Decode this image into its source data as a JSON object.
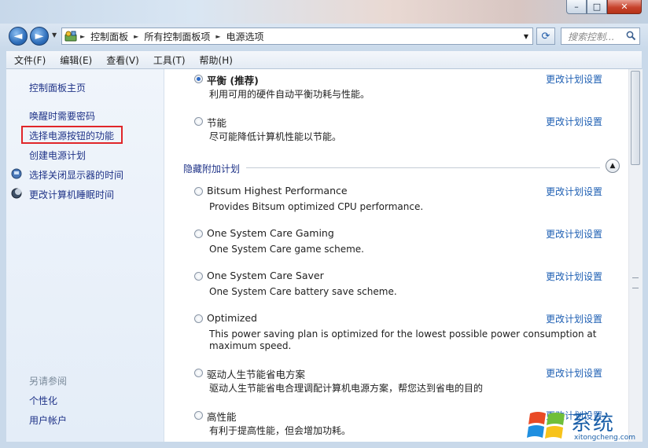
{
  "titlebar": {
    "minimize_label": "–",
    "maximize_label": "□",
    "close_label": "✕"
  },
  "navigation": {
    "back_label": "◄",
    "forward_label": "►",
    "breadcrumbs": [
      "控制面板",
      "所有控制面板项",
      "电源选项"
    ],
    "search_placeholder": "搜索控制..."
  },
  "menu": [
    "文件(F)",
    "编辑(E)",
    "查看(V)",
    "工具(T)",
    "帮助(H)"
  ],
  "sidebar": {
    "home": "控制面板主页",
    "links": [
      {
        "label": "唤醒时需要密码",
        "icon": ""
      },
      {
        "label": "选择电源按钮的功能",
        "icon": "",
        "highlighted": true
      },
      {
        "label": "创建电源计划",
        "icon": ""
      },
      {
        "label": "选择关闭显示器的时间",
        "icon": "monitor-icon"
      },
      {
        "label": "更改计算机睡眠时间",
        "icon": "moon-icon"
      }
    ],
    "see_also_header": "另请参阅",
    "see_also": [
      "个性化",
      "用户帐户"
    ]
  },
  "main": {
    "change_link_label": "更改计划设置",
    "top_plans": [
      {
        "name": "平衡 (推荐)",
        "desc": "利用可用的硬件自动平衡功耗与性能。",
        "selected": true
      },
      {
        "name": "节能",
        "desc": "尽可能降低计算机性能以节能。",
        "selected": false
      }
    ],
    "hidden_header": "隐藏附加计划",
    "hidden_plans": [
      {
        "name": "Bitsum Highest Performance",
        "desc": "Provides Bitsum optimized CPU performance."
      },
      {
        "name": "One System Care Gaming",
        "desc": "One System Care game scheme."
      },
      {
        "name": "One System Care Saver",
        "desc": "One System Care battery save scheme."
      },
      {
        "name": "Optimized",
        "desc": "This power saving plan is optimized for the lowest possible power consumption at maximum speed."
      },
      {
        "name": "驱动人生节能省电方案",
        "desc": "驱动人生节能省电合理调配计算机电源方案，帮您达到省电的目的"
      },
      {
        "name": "高性能",
        "desc": "有利于提高性能，但会增加功耗。"
      }
    ]
  },
  "watermark": {
    "text": "系统",
    "url": "xitongcheng.com"
  },
  "colors": {
    "link": "#1e5fb3",
    "sidebar_link": "#1e3287",
    "highlight_border": "#e0262a",
    "radio_selected": "#2f6bc7"
  }
}
